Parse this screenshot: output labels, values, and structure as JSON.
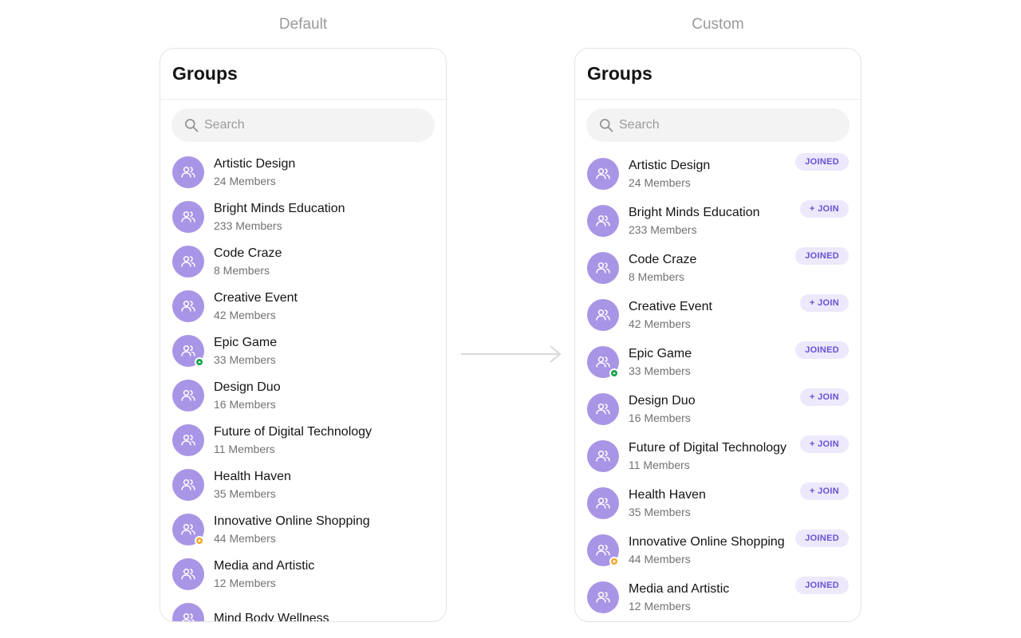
{
  "captions": {
    "default": "Default",
    "custom": "Custom"
  },
  "colors": {
    "avatar": "#a995e6",
    "accent": "#6852d6",
    "badge_bg": "#ede8fb",
    "online": "#16a34a",
    "private": "#f5a623"
  },
  "default_panel": {
    "title": "Groups",
    "search": {
      "placeholder": "Search",
      "value": ""
    },
    "groups": [
      {
        "name": "Artistic Design",
        "members": "24 Members",
        "status": ""
      },
      {
        "name": "Bright Minds Education",
        "members": "233 Members",
        "status": ""
      },
      {
        "name": "Code Craze",
        "members": "8 Members",
        "status": ""
      },
      {
        "name": "Creative Event",
        "members": "42 Members",
        "status": ""
      },
      {
        "name": "Epic Game",
        "members": "33 Members",
        "status": "green"
      },
      {
        "name": "Design Duo",
        "members": "16 Members",
        "status": ""
      },
      {
        "name": "Future of Digital Technology",
        "members": "11 Members",
        "status": ""
      },
      {
        "name": "Health Haven",
        "members": "35 Members",
        "status": ""
      },
      {
        "name": "Innovative Online Shopping",
        "members": "44 Members",
        "status": "orange"
      },
      {
        "name": "Media and Artistic",
        "members": "12 Members",
        "status": ""
      },
      {
        "name": "Mind Body Wellness",
        "members": "",
        "status": ""
      }
    ]
  },
  "custom_panel": {
    "title": "Groups",
    "search": {
      "placeholder": "Search",
      "value": ""
    },
    "groups": [
      {
        "name": "Artistic Design",
        "members": "24 Members",
        "status": "",
        "badge": "JOINED"
      },
      {
        "name": "Bright Minds Education",
        "members": "233 Members",
        "status": "",
        "badge": "+ JOIN"
      },
      {
        "name": "Code Craze",
        "members": "8 Members",
        "status": "",
        "badge": "JOINED"
      },
      {
        "name": "Creative Event",
        "members": "42 Members",
        "status": "",
        "badge": "+ JOIN"
      },
      {
        "name": "Epic Game",
        "members": "33 Members",
        "status": "green",
        "badge": "JOINED"
      },
      {
        "name": "Design Duo",
        "members": "16 Members",
        "status": "",
        "badge": "+ JOIN"
      },
      {
        "name": "Future of Digital Technology",
        "members": "11 Members",
        "status": "",
        "badge": "+ JOIN"
      },
      {
        "name": "Health Haven",
        "members": "35 Members",
        "status": "",
        "badge": "+ JOIN"
      },
      {
        "name": "Innovative Online Shopping",
        "members": "44 Members",
        "status": "orange",
        "badge": "JOINED"
      },
      {
        "name": "Media and Artistic",
        "members": "12 Members",
        "status": "",
        "badge": "JOINED"
      }
    ]
  }
}
